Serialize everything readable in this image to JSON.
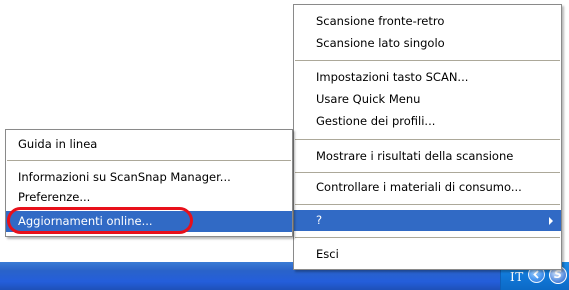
{
  "main_menu": {
    "items": [
      {
        "label": "Scansione fronte-retro"
      },
      {
        "label": "Scansione lato singolo"
      },
      {
        "label": "Impostazioni tasto SCAN..."
      },
      {
        "label": "Usare Quick Menu"
      },
      {
        "label": "Gestione dei profili..."
      },
      {
        "label": "Mostrare i risultati della scansione"
      },
      {
        "label": "Controllare i materiali di consumo..."
      },
      {
        "label": "?",
        "has_submenu": true,
        "highlighted": true
      },
      {
        "label": "Esci"
      }
    ]
  },
  "help_submenu": {
    "items": [
      {
        "label": "Guida in linea"
      },
      {
        "label": "Informazioni su ScanSnap Manager..."
      },
      {
        "label": "Preferenze..."
      },
      {
        "label": "Aggiornamenti online...",
        "highlighted": true,
        "callout": "red-oval"
      }
    ]
  },
  "taskbar": {
    "language": "IT",
    "tray_app_glyph": "S",
    "icons": [
      "tray-chevron-icon",
      "scansnap-manager-icon"
    ]
  },
  "colors": {
    "menu_highlight": "#316ac5",
    "callout_ring": "#e8101a",
    "taskbar": "#245edb",
    "tray": "#0f7bd9"
  }
}
